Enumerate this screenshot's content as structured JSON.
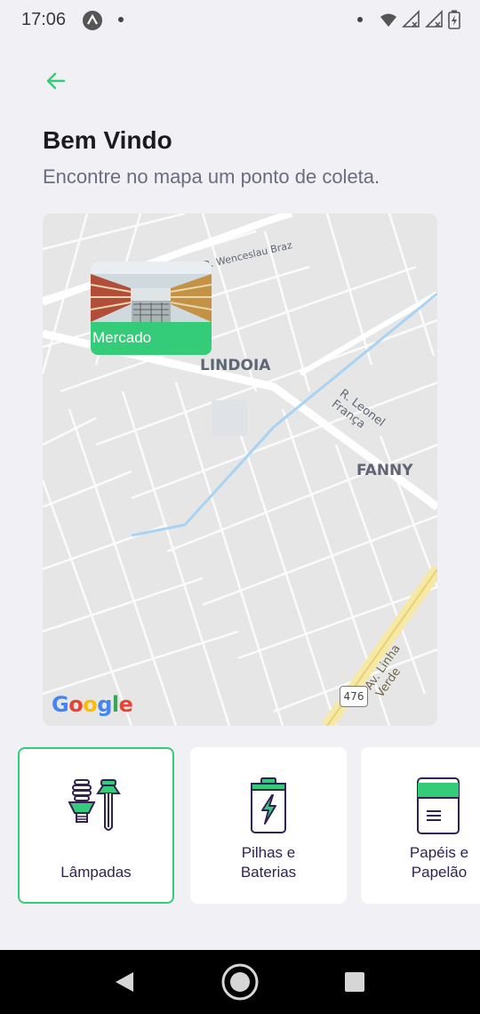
{
  "status_bar": {
    "time": "17:06"
  },
  "header": {
    "title": "Bem Vindo",
    "subtitle": "Encontre no mapa um ponto de coleta."
  },
  "map": {
    "marker": {
      "label": "Mercado"
    },
    "labels": {
      "neighborhood_1": "LINDOIA",
      "neighborhood_2": "FANNY",
      "street_1": "R. Wenceslau Braz",
      "street_2": "R. Leonel França",
      "street_3": "Av. Linha Verde",
      "route_number": "476"
    },
    "attribution": "Google"
  },
  "items": [
    {
      "title": "Lâmpadas",
      "selected": true
    },
    {
      "title": "Pilhas e\nBaterias",
      "selected": false
    },
    {
      "title": "Papéis e\nPapelão",
      "selected": false
    }
  ],
  "colors": {
    "accent": "#34cb79",
    "background": "#f0f0f5",
    "title": "#322153"
  }
}
